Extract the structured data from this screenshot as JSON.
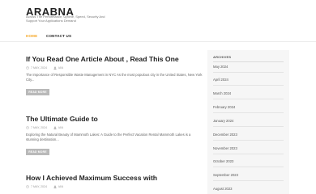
{
  "site": {
    "title": "ARABNA",
    "description": "Across The Performance, Uptime, Speed, Security And Support Your Applications Demand"
  },
  "nav": {
    "items": [
      {
        "label": "HOME"
      },
      {
        "label": "CONTACT US"
      }
    ],
    "active_color": "#f5a623"
  },
  "posts": [
    {
      "title": "If You Read One Article About , Read This One",
      "date": "7 MAY, 2024",
      "author": "IAN",
      "excerpt": "The Importance of Responsible Waste Management in NYC As the most populous city in the United States, New York City...",
      "read_more": "READ MORE"
    },
    {
      "title": "The Ultimate Guide to",
      "date": "7 MAY, 2024",
      "author": "IAN",
      "excerpt": "Exploring the Natural Beauty of Mammoth Lakes: A Guide to the Perfect Vacation Rental Mammoth Lakes is a stunning destination...",
      "read_more": "READ MORE"
    },
    {
      "title": "How I Achieved Maximum Success with",
      "date": "7 MAY, 2024",
      "author": "IAN"
    }
  ],
  "sidebar": {
    "archives_title": "ARCHIVES",
    "archives": [
      "May 2024",
      "April 2024",
      "March 2024",
      "February 2024",
      "January 2024",
      "December 2023",
      "November 2023",
      "October 2023",
      "September 2023",
      "August 2023"
    ]
  },
  "icons": {
    "date": "clock-icon",
    "author": "user-icon"
  }
}
